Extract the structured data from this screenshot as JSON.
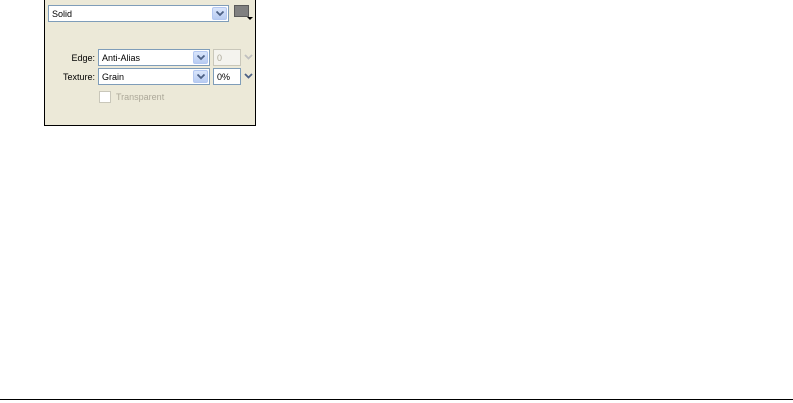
{
  "fill": {
    "type_value": "Solid",
    "color": "#808080"
  },
  "edge": {
    "label": "Edge:",
    "value": "Anti-Alias",
    "feather_value": "0"
  },
  "texture": {
    "label": "Texture:",
    "value": "Grain",
    "amount": "0%"
  },
  "transparent": {
    "label": "Transparent",
    "checked": false
  },
  "colors": {
    "panel_bg": "#ece9d8",
    "field_border": "#7f9db9",
    "disabled_text": "#aca899",
    "arrow_blue": "#4d6185"
  }
}
